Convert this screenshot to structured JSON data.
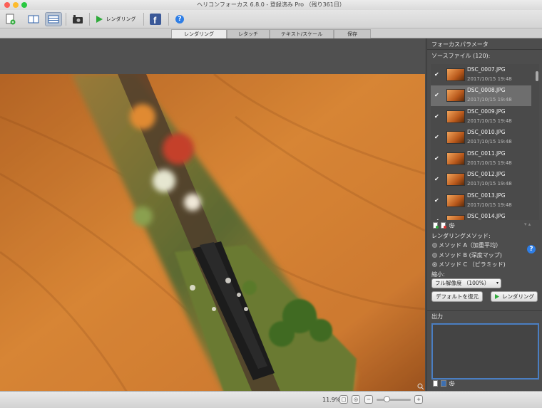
{
  "window": {
    "title": "ヘリコンフォーカス 6.8.0 - 登録済み Pro （残り361日）"
  },
  "toolbar": {
    "render_label": "レンダリング"
  },
  "tabs": [
    "レンダリング",
    "レタッチ",
    "テキスト/スケール",
    "保存"
  ],
  "panel": {
    "focus_params": "フォーカスパラメータ",
    "source_files": "ソースファイル (120):",
    "files": [
      {
        "name": "DSC_0007.JPG",
        "date": "2017/10/15 19:48"
      },
      {
        "name": "DSC_0008.JPG",
        "date": "2017/10/15 19:48"
      },
      {
        "name": "DSC_0009.JPG",
        "date": "2017/10/15 19:48"
      },
      {
        "name": "DSC_0010.JPG",
        "date": "2017/10/15 19:48"
      },
      {
        "name": "DSC_0011.JPG",
        "date": "2017/10/15 19:48"
      },
      {
        "name": "DSC_0012.JPG",
        "date": "2017/10/15 19:48"
      },
      {
        "name": "DSC_0013.JPG",
        "date": "2017/10/15 19:48"
      },
      {
        "name": "DSC_0014.JPG",
        "date": ""
      }
    ],
    "render_method": "レンダリングメソッド:",
    "methods": [
      "メソッド A（加重平均）",
      "メソッド B (深度マップ)",
      "メソッド C （ピラミッド)"
    ],
    "selected_method": 2,
    "reduce_label": "縮小:",
    "reduce_value": "フル解像度 （100%）",
    "default_button": "デフォルトを復元",
    "render_button": "レンダリング",
    "output_label": "出力"
  },
  "status": {
    "zoom": "11.9%"
  },
  "colors": {
    "accent": "#2e7ee6",
    "output_border": "#4a7ec2"
  }
}
